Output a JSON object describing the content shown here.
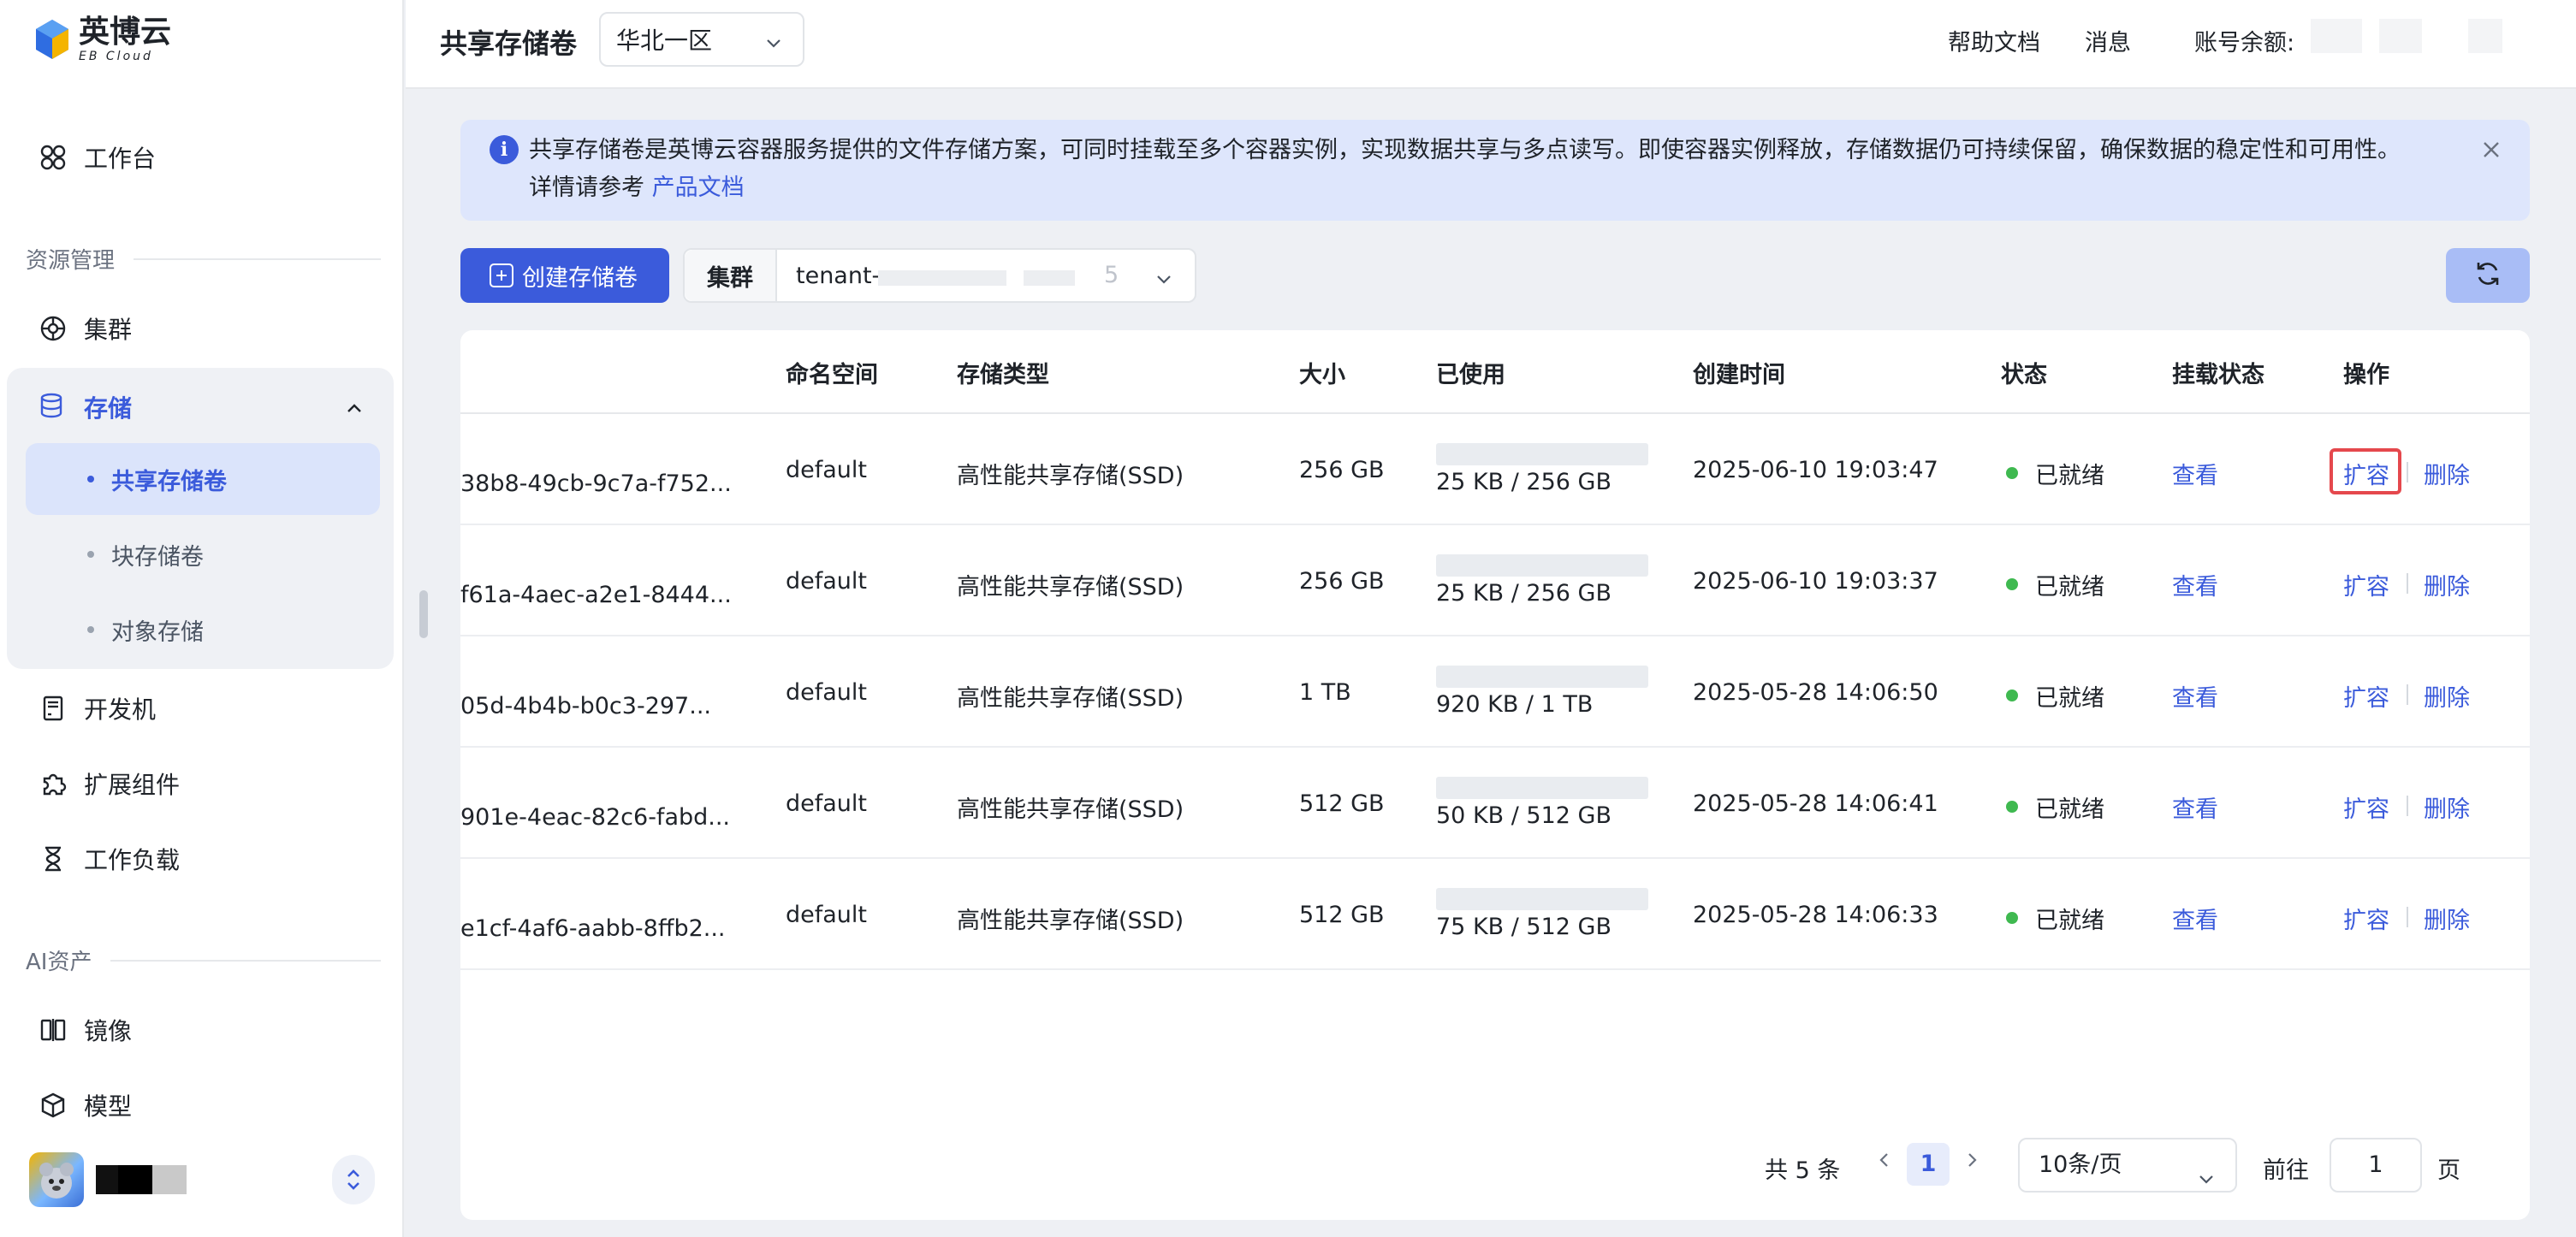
{
  "brand": {
    "name": "英博云",
    "subtitle": "EB Cloud"
  },
  "sidebar": {
    "workbench": "工作台",
    "section_resources": "资源管理",
    "cluster": "集群",
    "storage": "存储",
    "storage_children": [
      "共享存储卷",
      "块存储卷",
      "对象存储"
    ],
    "devbox": "开发机",
    "extensions": "扩展组件",
    "workloads": "工作负载",
    "section_ai": "AI资产",
    "images": "镜像",
    "models": "模型"
  },
  "header": {
    "title": "共享存储卷",
    "region": "华北一区",
    "help": "帮助文档",
    "messages": "消息",
    "balance_label": "账号余额:"
  },
  "banner": {
    "text": "共享存储卷是英博云容器服务提供的文件存储方案，可同时挂载至多个容器实例，实现数据共享与多点读写。即使容器实例释放，存储数据仍可持续保留，确保数据的稳定性和可用性。",
    "text2": "详情请参考",
    "link": "产品文档"
  },
  "toolbar": {
    "create_label": "创建存储卷",
    "cluster_label": "集群",
    "cluster_value": "tenant-",
    "cluster_suffix": "5"
  },
  "table": {
    "columns": [
      "命名空间",
      "存储类型",
      "大小",
      "已使用",
      "创建时间",
      "状态",
      "挂载状态",
      "操作"
    ],
    "rows": [
      {
        "name": "38b8-49cb-9c7a-f752...",
        "namespace": "default",
        "type": "高性能共享存储(SSD)",
        "size": "256 GB",
        "used": "25 KB / 256 GB",
        "created": "2025-06-10 19:03:47",
        "status": "已就绪",
        "mount": "查看",
        "expand": "扩容",
        "delete": "删除"
      },
      {
        "name": "f61a-4aec-a2e1-8444...",
        "namespace": "default",
        "type": "高性能共享存储(SSD)",
        "size": "256 GB",
        "used": "25 KB / 256 GB",
        "created": "2025-06-10 19:03:37",
        "status": "已就绪",
        "mount": "查看",
        "expand": "扩容",
        "delete": "删除"
      },
      {
        "name": "05d-4b4b-b0c3-297...",
        "namespace": "default",
        "type": "高性能共享存储(SSD)",
        "size": "1 TB",
        "used": "920 KB / 1 TB",
        "created": "2025-05-28 14:06:50",
        "status": "已就绪",
        "mount": "查看",
        "expand": "扩容",
        "delete": "删除"
      },
      {
        "name": "901e-4eac-82c6-fabd...",
        "namespace": "default",
        "type": "高性能共享存储(SSD)",
        "size": "512 GB",
        "used": "50 KB / 512 GB",
        "created": "2025-05-28 14:06:41",
        "status": "已就绪",
        "mount": "查看",
        "expand": "扩容",
        "delete": "删除"
      },
      {
        "name": "e1cf-4af6-aabb-8ffb2...",
        "namespace": "default",
        "type": "高性能共享存储(SSD)",
        "size": "512 GB",
        "used": "75 KB / 512 GB",
        "created": "2025-05-28 14:06:33",
        "status": "已就绪",
        "mount": "查看",
        "expand": "扩容",
        "delete": "删除"
      }
    ]
  },
  "pagination": {
    "total": "共 5 条",
    "current": "1",
    "page_size": "10条/页",
    "goto_label": "前往",
    "goto_value": "1",
    "page_unit": "页"
  },
  "colors": {
    "accent": "#3b5bdb",
    "ready": "#3fb950",
    "highlight": "#e5484d"
  },
  "icons": [
    "grid-icon",
    "cluster-icon",
    "database-icon",
    "chevron-up-icon",
    "devbox-icon",
    "puzzle-icon",
    "hourglass-icon",
    "image-icon",
    "cube-icon",
    "info-icon",
    "close-icon",
    "plus-square-icon",
    "chevron-down-icon",
    "refresh-icon",
    "chevron-left-icon",
    "chevron-right-icon",
    "switch-icon"
  ]
}
